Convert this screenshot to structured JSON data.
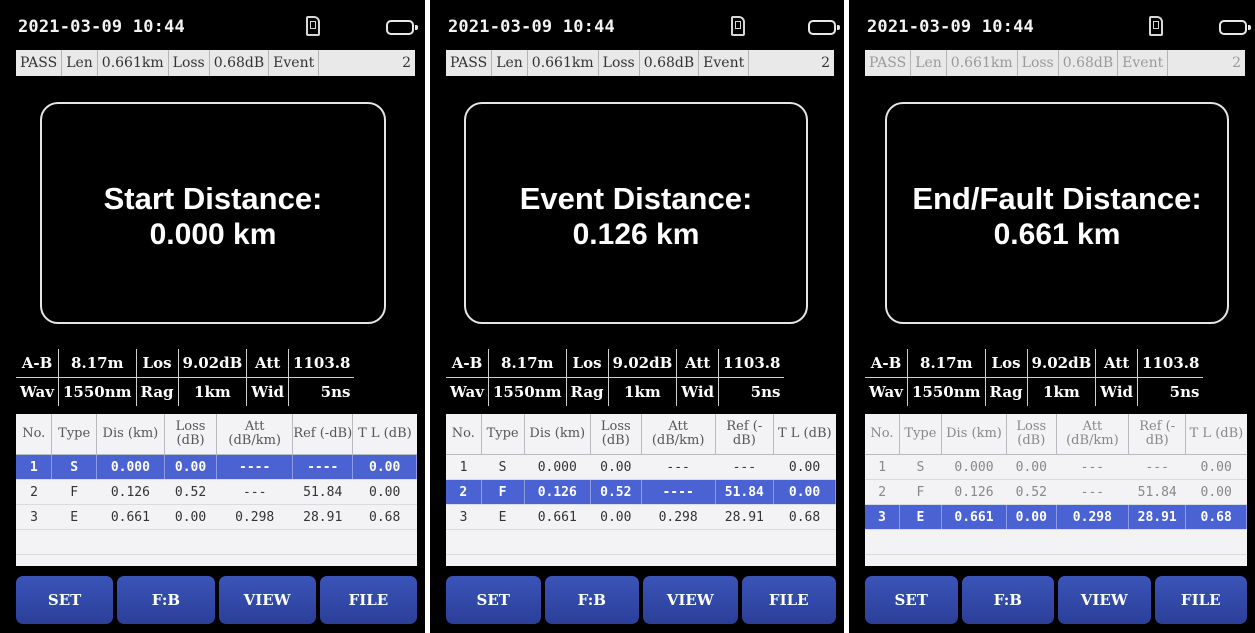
{
  "screens": [
    {
      "status": {
        "datetime": "2021-03-09 10:44",
        "icons": [
          "sd-card-icon",
          "battery-icon"
        ]
      },
      "summary": {
        "result": "PASS",
        "len_label": "Len",
        "len_value": "0.661km",
        "loss_label": "Loss",
        "loss_value": "0.68dB",
        "event_label": "Event",
        "event_count": "2"
      },
      "distance": {
        "label": "Start Distance:",
        "value": "0.000 km"
      },
      "info": {
        "ab_label": "A-B",
        "ab_value": "8.17m",
        "los_label": "Los",
        "los_value": "9.02dB",
        "att_label": "Att",
        "att_value": "1103.8",
        "wav_label": "Wav",
        "wav_value": "1550nm",
        "rag_label": "Rag",
        "rag_value": "1km",
        "wid_label": "Wid",
        "wid_value": "5ns"
      },
      "table": {
        "headers": [
          "No.",
          "Type",
          "Dis (km)",
          "Loss (dB)",
          "Att (dB/km)",
          "Ref (-dB)",
          "T L (dB)"
        ],
        "rows": [
          [
            "1",
            "S",
            "0.000",
            "0.00",
            "----",
            "----",
            "0.00"
          ],
          [
            "2",
            "F",
            "0.126",
            "0.52",
            "---",
            "51.84",
            "0.00"
          ],
          [
            "3",
            "E",
            "0.661",
            "0.00",
            "0.298",
            "28.91",
            "0.68"
          ]
        ],
        "selected_row": 0
      },
      "softkeys": [
        "SET",
        "F:B",
        "VIEW",
        "FILE"
      ]
    },
    {
      "status": {
        "datetime": "2021-03-09 10:44",
        "icons": [
          "sd-card-icon",
          "battery-icon"
        ]
      },
      "summary": {
        "result": "PASS",
        "len_label": "Len",
        "len_value": "0.661km",
        "loss_label": "Loss",
        "loss_value": "0.68dB",
        "event_label": "Event",
        "event_count": "2"
      },
      "distance": {
        "label": "Event Distance:",
        "value": "0.126 km"
      },
      "info": {
        "ab_label": "A-B",
        "ab_value": "8.17m",
        "los_label": "Los",
        "los_value": "9.02dB",
        "att_label": "Att",
        "att_value": "1103.8",
        "wav_label": "Wav",
        "wav_value": "1550nm",
        "rag_label": "Rag",
        "rag_value": "1km",
        "wid_label": "Wid",
        "wid_value": "5ns"
      },
      "table": {
        "headers": [
          "No.",
          "Type",
          "Dis (km)",
          "Loss (dB)",
          "Att (dB/km)",
          "Ref (-dB)",
          "T L (dB)"
        ],
        "rows": [
          [
            "1",
            "S",
            "0.000",
            "0.00",
            "---",
            "---",
            "0.00"
          ],
          [
            "2",
            "F",
            "0.126",
            "0.52",
            "----",
            "51.84",
            "0.00"
          ],
          [
            "3",
            "E",
            "0.661",
            "0.00",
            "0.298",
            "28.91",
            "0.68"
          ]
        ],
        "selected_row": 1
      },
      "softkeys": [
        "SET",
        "F:B",
        "VIEW",
        "FILE"
      ]
    },
    {
      "status": {
        "datetime": "2021-03-09 10:44",
        "icons": [
          "sd-card-icon",
          "battery-icon"
        ]
      },
      "summary": {
        "result": "PASS",
        "len_label": "Len",
        "len_value": "0.661km",
        "loss_label": "Loss",
        "loss_value": "0.68dB",
        "event_label": "Event",
        "event_count": "2"
      },
      "distance": {
        "label": "End/Fault Distance:",
        "value": "0.661 km"
      },
      "info": {
        "ab_label": "A-B",
        "ab_value": "8.17m",
        "los_label": "Los",
        "los_value": "9.02dB",
        "att_label": "Att",
        "att_value": "1103.8",
        "wav_label": "Wav",
        "wav_value": "1550nm",
        "rag_label": "Rag",
        "rag_value": "1km",
        "wid_label": "Wid",
        "wid_value": "5ns"
      },
      "table": {
        "headers": [
          "No.",
          "Type",
          "Dis (km)",
          "Loss (dB)",
          "Att (dB/km)",
          "Ref (-dB)",
          "T L (dB)"
        ],
        "rows": [
          [
            "1",
            "S",
            "0.000",
            "0.00",
            "---",
            "---",
            "0.00"
          ],
          [
            "2",
            "F",
            "0.126",
            "0.52",
            "---",
            "51.84",
            "0.00"
          ],
          [
            "3",
            "E",
            "0.661",
            "0.00",
            "0.298",
            "28.91",
            "0.68"
          ]
        ],
        "selected_row": 2
      },
      "softkeys": [
        "SET",
        "F:B",
        "VIEW",
        "FILE"
      ]
    }
  ],
  "colors": {
    "selected_row": "#4b62d2",
    "softkey": "#3048a8",
    "screen_bg": "#000000",
    "table_bg": "#f3f3f6"
  }
}
